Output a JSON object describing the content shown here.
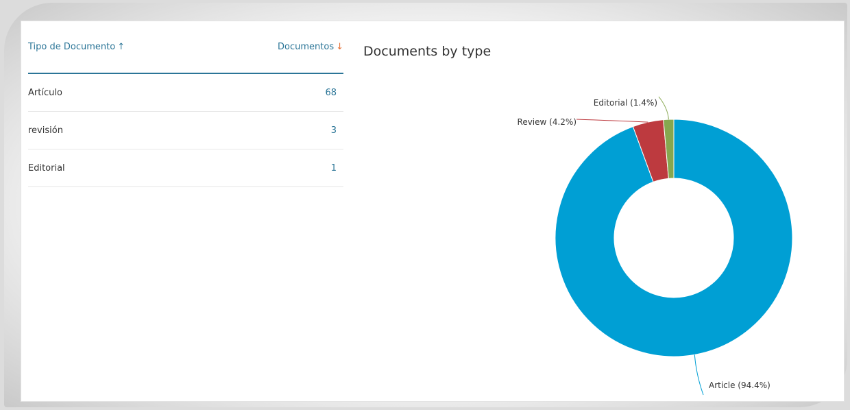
{
  "table": {
    "headers": {
      "type_label": "Tipo de Documento",
      "type_sort_icon": "arrow-up",
      "count_label": "Documentos",
      "count_sort_icon": "arrow-down"
    },
    "rows": [
      {
        "type": "Artículo",
        "count": "68"
      },
      {
        "type": "revisión",
        "count": "3"
      },
      {
        "type": "Editorial",
        "count": "1"
      }
    ]
  },
  "chart_title": "Documents by type",
  "colors": {
    "accent": "#2b7597",
    "sort_down": "#e8743b",
    "article": "#009fd4",
    "review": "#bd3a3f",
    "editorial": "#86a74f"
  },
  "chart_data": {
    "type": "pie",
    "title": "Documents by type",
    "donut": true,
    "slices": [
      {
        "label": "Article (94.4%)",
        "value": 94.4
      },
      {
        "label": "Review (4.2%)",
        "value": 4.2
      },
      {
        "label": "Editorial (1.4%)",
        "value": 1.4
      }
    ]
  }
}
